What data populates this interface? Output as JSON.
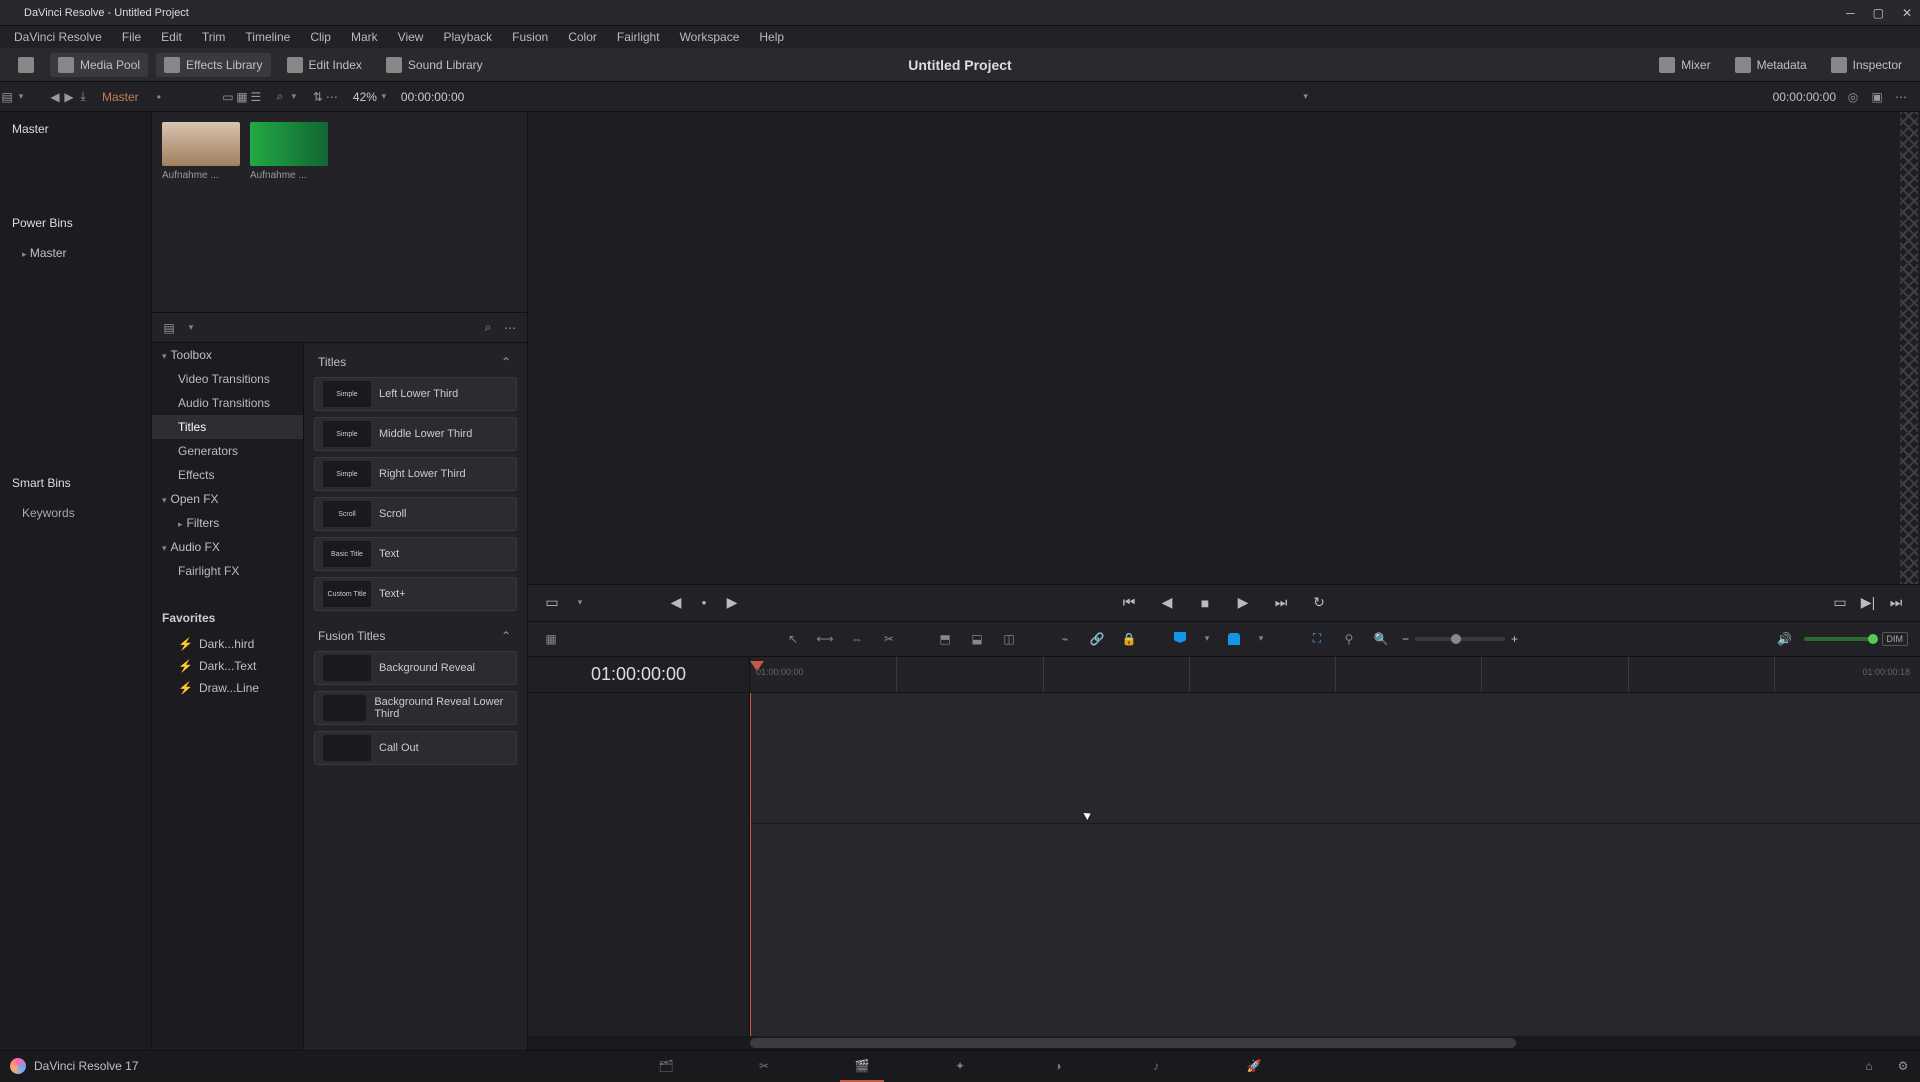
{
  "window": {
    "title": "DaVinci Resolve - Untitled Project"
  },
  "menu": [
    "DaVinci Resolve",
    "File",
    "Edit",
    "Trim",
    "Timeline",
    "Clip",
    "Mark",
    "View",
    "Playback",
    "Fusion",
    "Color",
    "Fairlight",
    "Workspace",
    "Help"
  ],
  "toolbar": {
    "media_pool": "Media Pool",
    "effects_lib": "Effects Library",
    "edit_index": "Edit Index",
    "sound_lib": "Sound Library",
    "mixer": "Mixer",
    "metadata": "Metadata",
    "inspector": "Inspector",
    "project": "Untitled Project"
  },
  "toolbar2": {
    "breadcrumb": "Master",
    "zoom": "42%",
    "tc_left": "00:00:00:00",
    "tc_right": "00:00:00:00"
  },
  "bins": {
    "master": "Master",
    "power": "Power Bins",
    "power_sub": "Master",
    "smart": "Smart Bins",
    "keywords": "Keywords"
  },
  "clips": [
    {
      "label": "Aufnahme ..."
    },
    {
      "label": "Aufnahme ..."
    }
  ],
  "eff_tree": {
    "toolbox": "Toolbox",
    "items": [
      "Video Transitions",
      "Audio Transitions",
      "Titles",
      "Generators",
      "Effects"
    ],
    "openfx": "Open FX",
    "filters": "Filters",
    "audiofx": "Audio FX",
    "fairlight": "Fairlight FX",
    "favorites": "Favorites",
    "fav_items": [
      "Dark...hird",
      "Dark...Text",
      "Draw...Line"
    ]
  },
  "titles": {
    "header": "Titles",
    "items": [
      {
        "swatch": "Simple",
        "name": "Left Lower Third"
      },
      {
        "swatch": "Simple",
        "name": "Middle Lower Third"
      },
      {
        "swatch": "Simple",
        "name": "Right Lower Third"
      },
      {
        "swatch": "Scroll",
        "name": "Scroll"
      },
      {
        "swatch": "Basic Title",
        "name": "Text"
      },
      {
        "swatch": "Custom Title",
        "name": "Text+"
      }
    ],
    "fusion_header": "Fusion Titles",
    "fusion_items": [
      {
        "swatch": "",
        "name": "Background Reveal"
      },
      {
        "swatch": "",
        "name": "Background Reveal Lower Third"
      },
      {
        "swatch": "",
        "name": "Call Out"
      }
    ]
  },
  "timeline": {
    "tc": "01:00:00:00",
    "ruler_start": "01:00:00:00",
    "ruler_end": "01:00:00:18"
  },
  "edit_tools": {
    "dim": "DIM"
  },
  "footer": {
    "app": "DaVinci Resolve 17"
  }
}
